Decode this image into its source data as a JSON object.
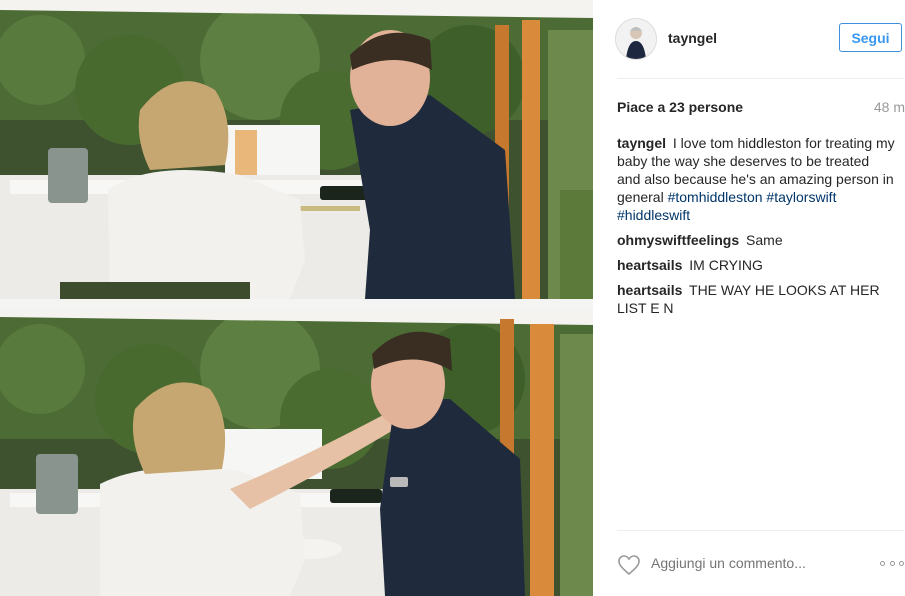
{
  "post": {
    "username": "tayngel",
    "follow_label": "Segui",
    "likes_text": "Piace a 23 persone",
    "time_ago": "48 m",
    "comments": [
      {
        "user": "tayngel",
        "text": "I love tom hiddleston for treating my baby the way she deserves to be treated and also because he's an amazing person in general",
        "tags": "#tomhiddleston #taylorswift #hiddleswift"
      },
      {
        "user": "ohmyswiftfeelings",
        "text": "Same"
      },
      {
        "user": "heartsails",
        "text": "IM CRYING"
      },
      {
        "user": "heartsails",
        "text": "THE WAY HE LOOKS AT HER LIST E N"
      }
    ],
    "comment_placeholder": "Aggiungi un commento..."
  },
  "icons": {
    "like": "heart-outline-icon",
    "more": "more-options-icon"
  },
  "colors": {
    "link_blue": "#3897f0",
    "hashtag": "#003569",
    "muted": "#999999",
    "divider": "#efefef"
  }
}
